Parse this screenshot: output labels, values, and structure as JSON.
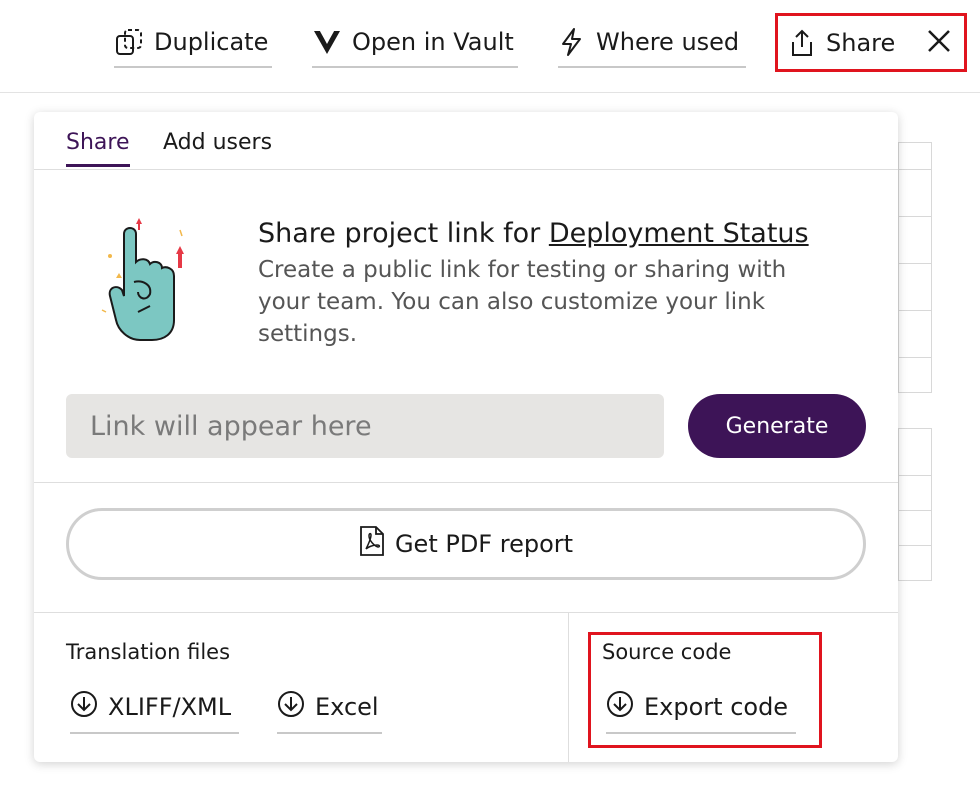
{
  "toolbar": {
    "duplicate_label": "Duplicate",
    "open_vault_label": "Open in Vault",
    "where_used_label": "Where used",
    "share_label": "Share"
  },
  "tabs": [
    {
      "label": "Share",
      "active": true
    },
    {
      "label": "Add users",
      "active": false
    }
  ],
  "share": {
    "headline_prefix": "Share project link for ",
    "project_name": "Deployment Status",
    "description": "Create a public link for testing or sharing with your team. You can also customize your link settings.",
    "link_placeholder": "Link will appear here",
    "generate_label": "Generate",
    "pdf_label": "Get PDF report"
  },
  "translation": {
    "title": "Translation files",
    "xliff_label": "XLIFF/XML",
    "excel_label": "Excel"
  },
  "source": {
    "title": "Source code",
    "export_label": "Export code"
  },
  "colors": {
    "accent": "#3d1457",
    "highlight": "#e0141e",
    "input_bg": "#e6e5e3"
  }
}
